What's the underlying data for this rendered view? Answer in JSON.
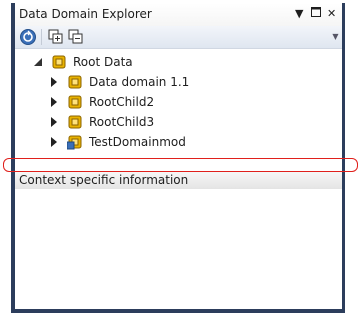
{
  "window": {
    "title": "Data Domain Explorer"
  },
  "toolbar": {
    "buttons": [
      {
        "icon": "globe-refresh-icon"
      },
      {
        "icon": "expand-all-icon"
      },
      {
        "icon": "collapse-all-icon"
      }
    ]
  },
  "tree": {
    "root": {
      "label": "Root Data",
      "expanded": true
    },
    "children": [
      {
        "label": "Data domain 1.1"
      },
      {
        "label": "RootChild2"
      },
      {
        "label": "RootChild3"
      },
      {
        "label": "TestDomainmod"
      }
    ]
  },
  "context_panel": {
    "label": "Context specific information"
  }
}
